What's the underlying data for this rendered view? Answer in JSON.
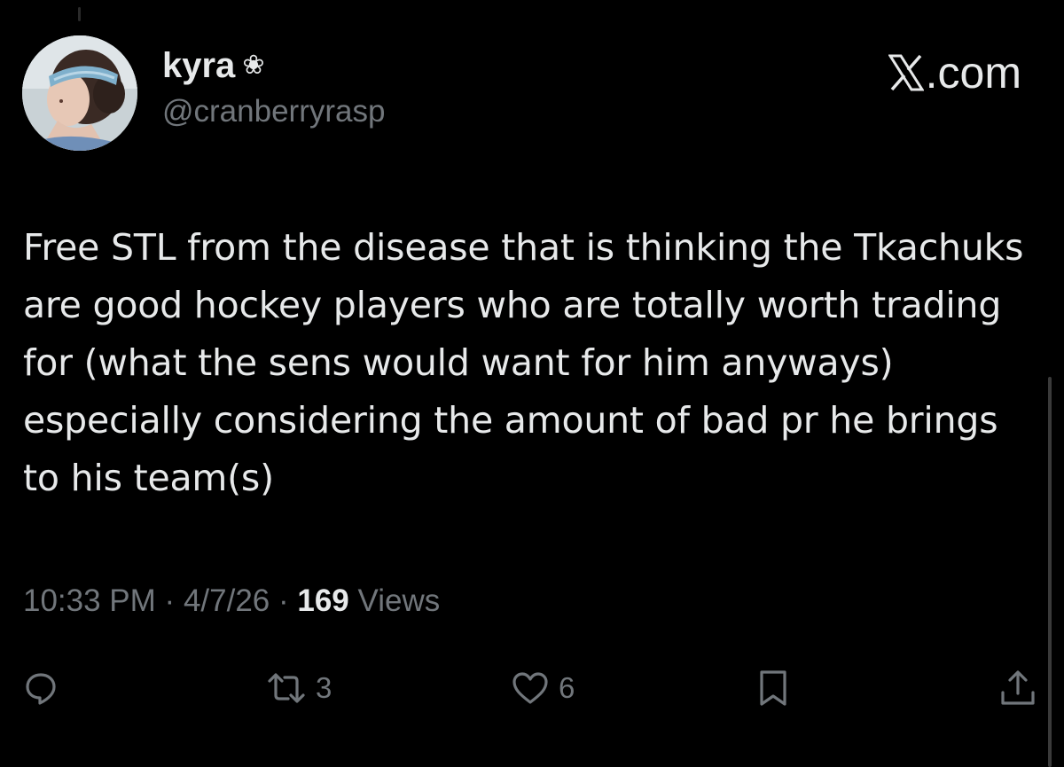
{
  "author": {
    "display_name": "kyra",
    "badge_glyph": "❀",
    "handle": "@cranberryrasp"
  },
  "brand": {
    "label": ".com",
    "logo_icon": "x-logo-icon"
  },
  "tweet": {
    "text": "Free STL from the disease that is thinking the Tkachuks are good hockey players who are totally worth trading for (what the sens would want for him anyways) especially considering the amount of bad pr he brings to his team(s)"
  },
  "meta": {
    "time": "10:33 PM",
    "separator": "·",
    "date": "4/7/26",
    "views_count": "169",
    "views_label": "Views"
  },
  "actions": {
    "reply": {
      "icon": "reply-icon",
      "count": ""
    },
    "retweet": {
      "icon": "retweet-icon",
      "count": "3"
    },
    "like": {
      "icon": "heart-icon",
      "count": "6"
    },
    "bookmark": {
      "icon": "bookmark-icon",
      "count": ""
    },
    "share": {
      "icon": "share-icon",
      "count": ""
    }
  },
  "colors": {
    "background": "#000000",
    "primary_text": "#e7e9ea",
    "secondary_text": "#71767b"
  }
}
